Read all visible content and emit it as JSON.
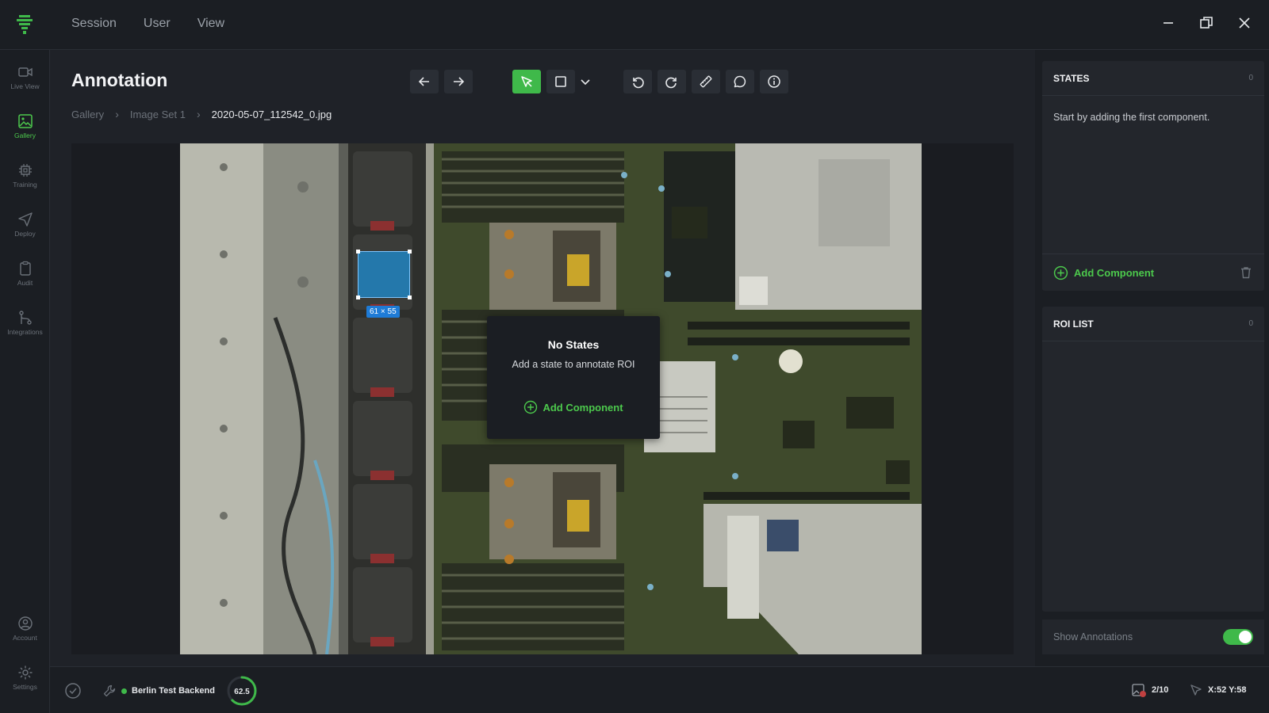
{
  "topbar": {
    "menu": [
      "Session",
      "User",
      "View"
    ],
    "icons": [
      "logo-icon",
      "minimize-icon",
      "restore-icon",
      "close-icon"
    ]
  },
  "sidebar": {
    "items": [
      {
        "label": "Live View",
        "icon": "video-camera-icon"
      },
      {
        "label": "Gallery",
        "icon": "image-icon",
        "active": true
      },
      {
        "label": "Training",
        "icon": "chip-icon"
      },
      {
        "label": "Deploy",
        "icon": "send-icon"
      },
      {
        "label": "Audit",
        "icon": "clipboard-icon"
      },
      {
        "label": "Integrations",
        "icon": "git-icon"
      },
      {
        "label": "Account",
        "icon": "user-circle-icon"
      },
      {
        "label": "Settings",
        "icon": "gear-icon"
      }
    ]
  },
  "main": {
    "title": "Annotation",
    "breadcrumb": [
      "Gallery",
      "Image Set 1",
      "2020-05-07_112542_0.jpg"
    ]
  },
  "canvas": {
    "roi_size": "61 × 55",
    "no_states_title": "No States",
    "no_states_subtitle": "Add a state to annotate ROI",
    "no_states_action": "Add Component"
  },
  "states": {
    "title": "STATES",
    "count": "0",
    "empty_text": "Start by adding the first component.",
    "add_label": "Add Component"
  },
  "roi_list": {
    "title": "ROI LIST",
    "count": "0"
  },
  "show_annotations": {
    "label": "Show Annotations",
    "enabled": true
  },
  "status": {
    "backend": "Berlin Test Backend",
    "gauge_value": "62.5",
    "gauge_fraction": 0.625,
    "image_counter": "2/10",
    "coords": "X:52  Y:58"
  },
  "colors": {
    "accent": "#3fb94a",
    "roi": "#1e8cd2",
    "background": "#1b1e23"
  }
}
